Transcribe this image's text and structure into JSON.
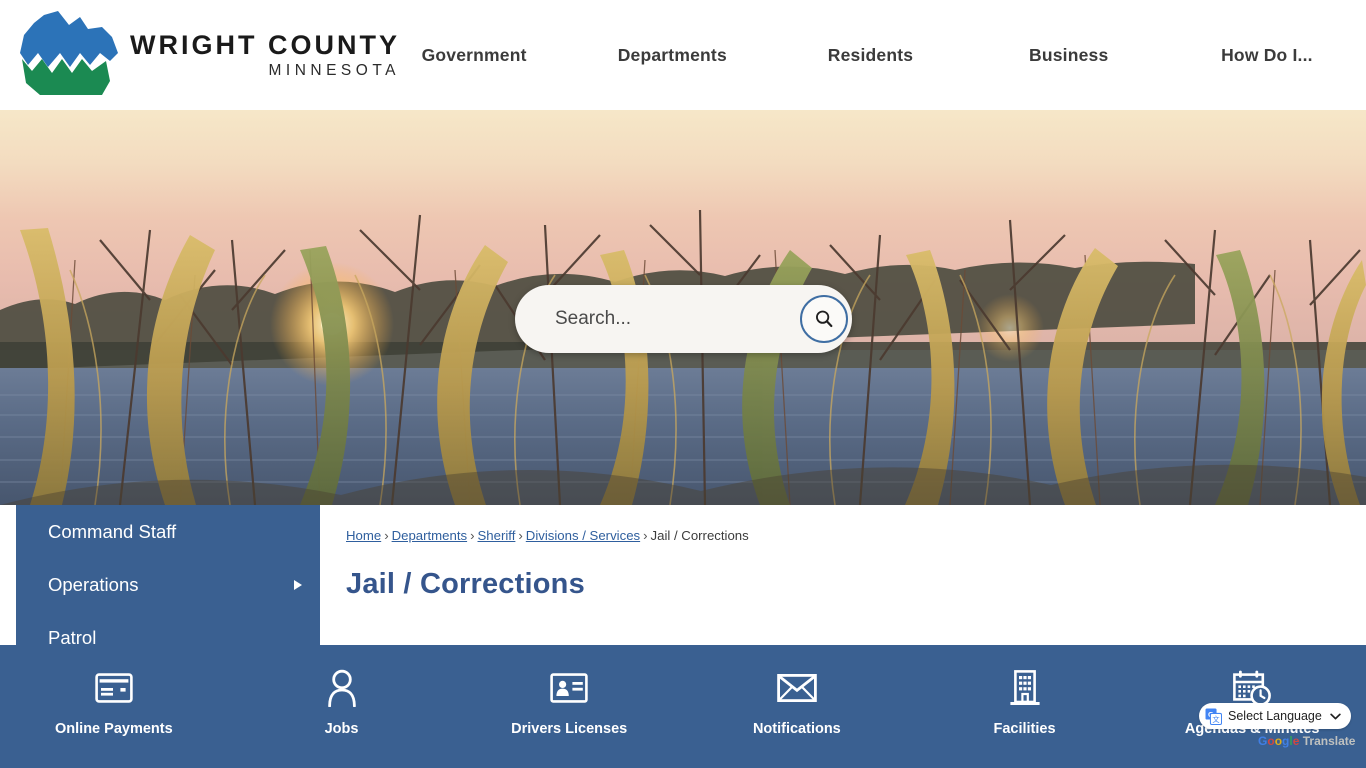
{
  "header": {
    "logo": {
      "title": "WRIGHT COUNTY",
      "subtitle": "MINNESOTA",
      "icon": "wright-county-logo",
      "blue": "#2c73b8",
      "green": "#1b8a52"
    },
    "nav": [
      {
        "label": "Government"
      },
      {
        "label": "Departments"
      },
      {
        "label": "Residents"
      },
      {
        "label": "Business"
      },
      {
        "label": "How Do I..."
      }
    ]
  },
  "hero": {
    "alt": "Sunset over a lake framed by tall autumn reeds and bare branches",
    "search": {
      "placeholder": "Search...",
      "value": "",
      "button_icon": "search-icon",
      "accent": "#3f6ea3"
    }
  },
  "sidebar": {
    "background": "#3a6091",
    "items": [
      {
        "label": "Command Staff",
        "has_submenu": false
      },
      {
        "label": "Operations",
        "has_submenu": true
      },
      {
        "label": "Patrol",
        "has_submenu": false
      }
    ]
  },
  "main": {
    "breadcrumb": {
      "links": [
        {
          "label": "Home"
        },
        {
          "label": "Departments"
        },
        {
          "label": "Sheriff"
        },
        {
          "label": "Divisions / Services"
        }
      ],
      "separator": "›",
      "current": "Jail / Corrections"
    },
    "title": "Jail / Corrections",
    "title_color": "#35558c"
  },
  "footer": {
    "background": "#3a6091",
    "items": [
      {
        "label": "Online Payments",
        "icon": "credit-card-icon"
      },
      {
        "label": "Jobs",
        "icon": "person-icon"
      },
      {
        "label": "Drivers Licenses",
        "icon": "id-card-icon"
      },
      {
        "label": "Notifications",
        "icon": "envelope-icon"
      },
      {
        "label": "Facilities",
        "icon": "building-icon"
      },
      {
        "label": "Agendas & Minutes",
        "icon": "calendar-clock-icon"
      }
    ]
  },
  "translate": {
    "label": "Select Language",
    "icon": "google-translate-icon",
    "chevron": "chevron-down-icon",
    "brand": {
      "g": "G",
      "o1": "o",
      "o2": "o",
      "g2": "g",
      "l": "l",
      "e": "e",
      "suffix": " Translate"
    }
  }
}
